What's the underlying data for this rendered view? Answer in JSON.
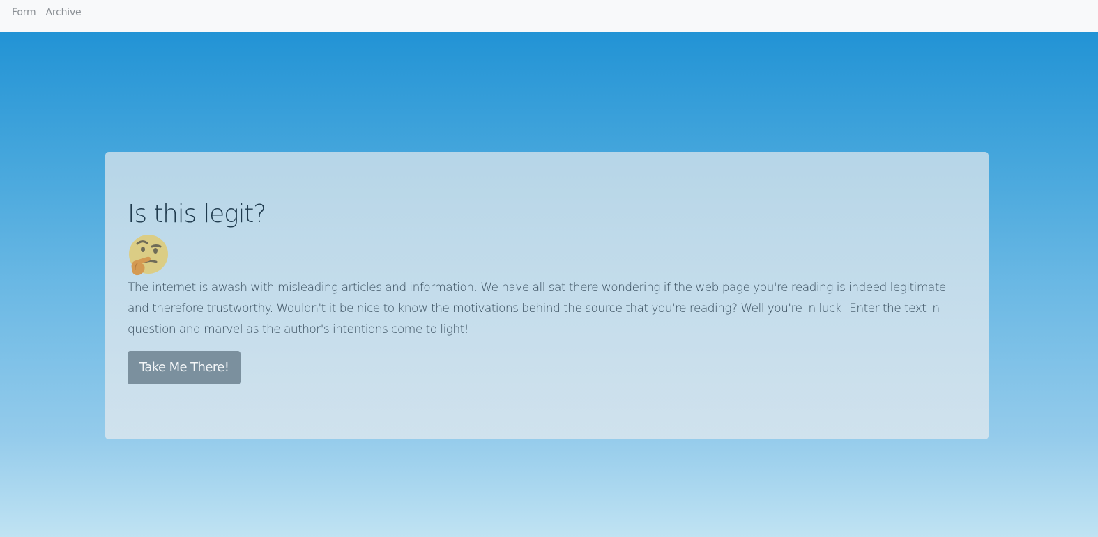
{
  "nav": {
    "items": [
      {
        "label": "Form"
      },
      {
        "label": "Archive"
      }
    ]
  },
  "hero": {
    "title": "Is this legit?",
    "emoji_icon": "thinking-face-icon",
    "description": "The internet is awash with misleading articles and information. We have all sat there wondering if the web page you're reading is indeed legitimate and therefore trustworthy. Wouldn't it be nice to know the motivations behind the source that you're reading? Well you're in luck! Enter the text in question and marvel as the author's intentions come to light!",
    "cta_label": "Take Me There!"
  },
  "colors": {
    "navbar_bg": "#f8f9fa",
    "gradient_top": "#2293d5",
    "gradient_bottom": "#c0e3f3",
    "button_bg": "#7b909e",
    "title_color": "#1f3a4d"
  }
}
